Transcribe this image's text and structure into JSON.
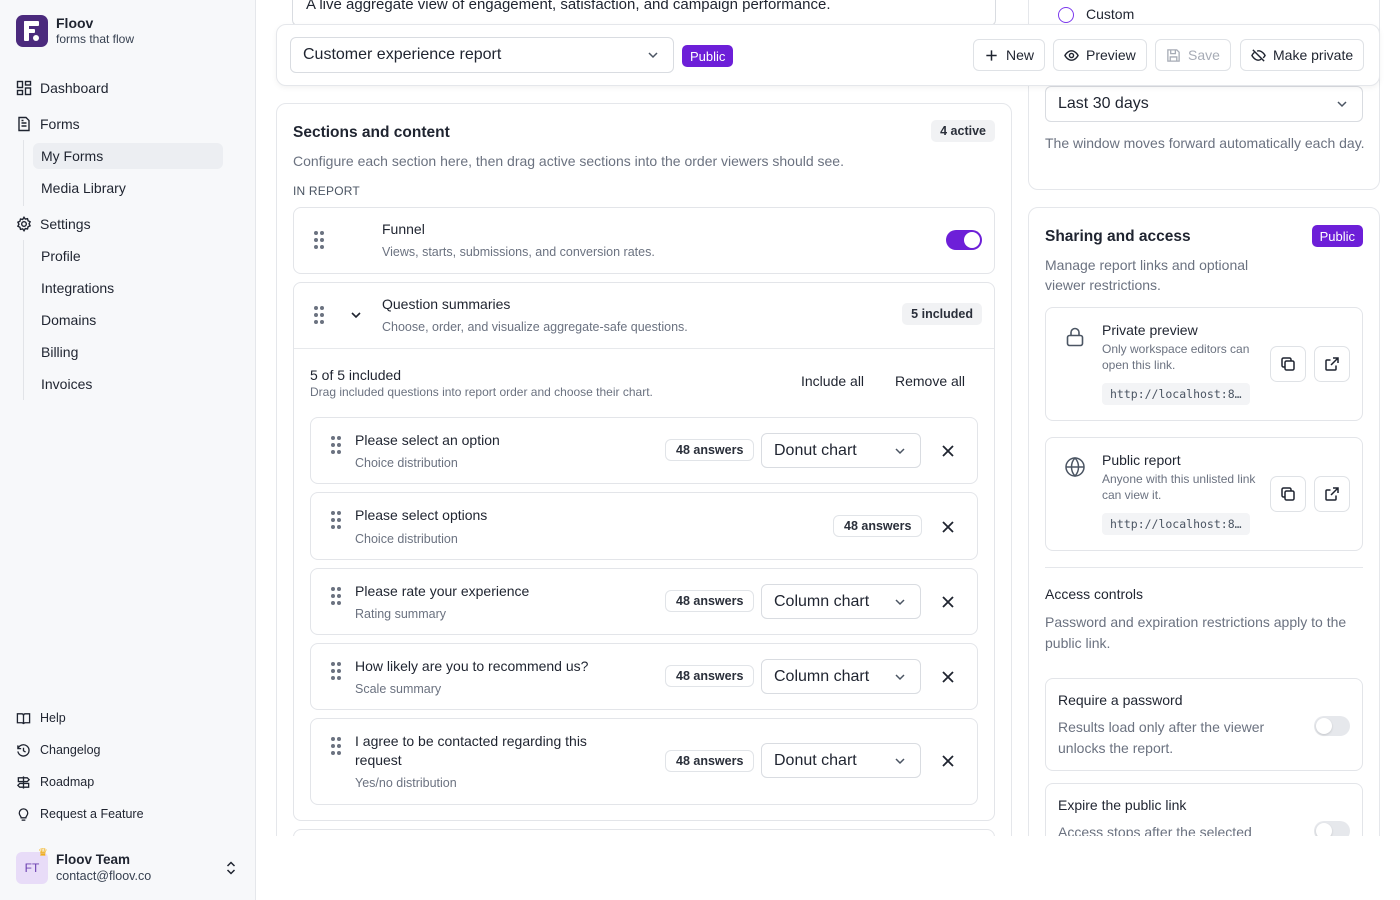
{
  "brand": {
    "name": "Floov",
    "tagline": "forms that flow"
  },
  "nav": {
    "dashboard": "Dashboard",
    "forms": "Forms",
    "forms_items": [
      "My Forms",
      "Media Library"
    ],
    "settings": "Settings",
    "settings_items": [
      "Profile",
      "Integrations",
      "Domains",
      "Billing",
      "Invoices"
    ]
  },
  "footer_nav": {
    "help": "Help",
    "changelog": "Changelog",
    "roadmap": "Roadmap",
    "request": "Request a Feature"
  },
  "user": {
    "initials": "FT",
    "name": "Floov Team",
    "email": "contact@floov.co"
  },
  "description_field": {
    "value": "A live aggregate view of engagement, satisfaction, and campaign performance."
  },
  "toolbar": {
    "report_name": "Customer experience report",
    "visibility_badge": "Public",
    "new_label": "New",
    "preview_label": "Preview",
    "save_label": "Save",
    "make_private_label": "Make private"
  },
  "date_range": {
    "custom_option": "Custom",
    "selected": "Last 30 days",
    "hint": "The window moves forward automatically each day."
  },
  "sections": {
    "title": "Sections and content",
    "active_count": "4 active",
    "subtitle": "Configure each section here, then drag active sections into the order viewers should see.",
    "group_label": "IN REPORT",
    "funnel": {
      "title": "Funnel",
      "desc": "Views, starts, submissions, and conversion rates.",
      "enabled": true
    },
    "question_summaries": {
      "title": "Question summaries",
      "desc": "Choose, order, and visualize aggregate-safe questions.",
      "included_badge": "5 included",
      "count_text": "5 of 5 included",
      "help": "Drag included questions into report order and choose their chart.",
      "include_all": "Include all",
      "remove_all": "Remove all",
      "questions": [
        {
          "title": "Please select an option",
          "type": "Choice distribution",
          "answers": "48 answers",
          "chart": "Donut chart"
        },
        {
          "title": "Please select options",
          "type": "Choice distribution",
          "answers": "48 answers",
          "chart": ""
        },
        {
          "title": "Please rate your experience",
          "type": "Rating summary",
          "answers": "48 answers",
          "chart": "Column chart"
        },
        {
          "title": "How likely are you to recommend us?",
          "type": "Scale summary",
          "answers": "48 answers",
          "chart": "Column chart"
        },
        {
          "title": "I agree to be contacted regarding this request",
          "type": "Yes/no distribution",
          "answers": "48 answers",
          "chart": "Donut chart"
        }
      ]
    }
  },
  "sharing": {
    "title": "Sharing and access",
    "badge": "Public",
    "subtitle": "Manage report links and optional viewer restrictions.",
    "private_preview": {
      "title": "Private preview",
      "desc": "Only workspace editors can open this link.",
      "url": "http://localhost:8…"
    },
    "public_report": {
      "title": "Public report",
      "desc": "Anyone with this unlisted link can view it.",
      "url": "http://localhost:8…"
    },
    "access_controls": {
      "title": "Access controls",
      "desc": "Password and expiration restrictions apply to the public link."
    },
    "password": {
      "title": "Require a password",
      "desc": "Results load only after the viewer unlocks the report.",
      "enabled": false
    },
    "expire": {
      "title": "Expire the public link",
      "desc": "Access stops after the selected",
      "enabled": false
    }
  }
}
